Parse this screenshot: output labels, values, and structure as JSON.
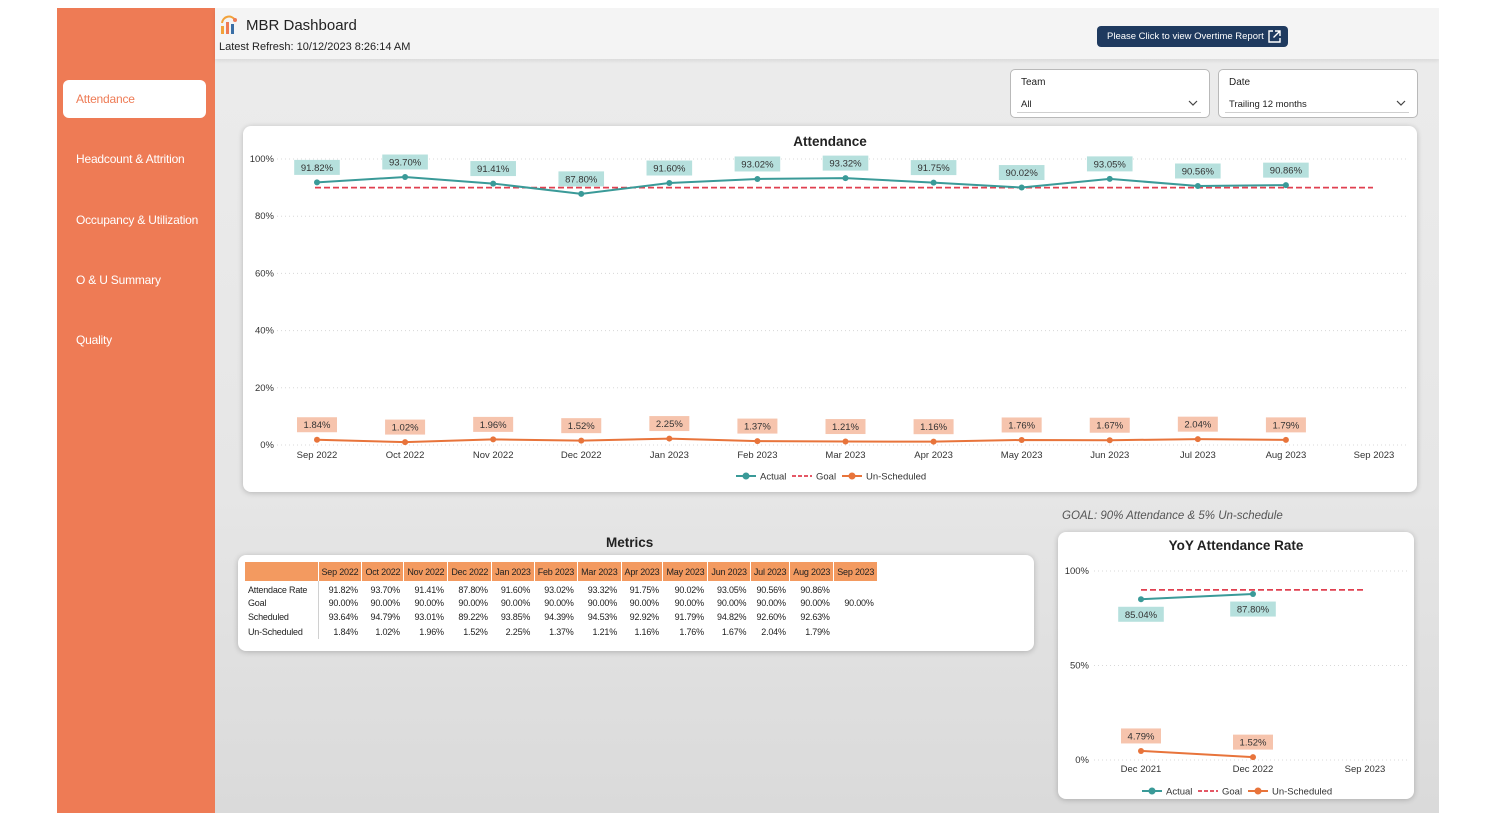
{
  "app": {
    "title": "MBR Dashboard",
    "refresh_label": "Latest Refresh: 10/12/2023 8:26:14 AM",
    "overtime_button": "Please Click to view Overtime Report"
  },
  "sidebar": {
    "items": [
      {
        "label": "Attendance",
        "active": true
      },
      {
        "label": "Headcount & Attrition",
        "active": false
      },
      {
        "label": "Occupancy & Utilization",
        "active": false
      },
      {
        "label": "O & U Summary",
        "active": false
      },
      {
        "label": "Quality",
        "active": false
      }
    ]
  },
  "filters": {
    "team": {
      "label": "Team",
      "value": "All"
    },
    "date": {
      "label": "Date",
      "value": "Trailing 12 months"
    }
  },
  "colors": {
    "brand": "#ee7b55",
    "actual": "#3a9a98",
    "goal": "#e04050",
    "unscheduled": "#e8743b",
    "actual_label_bg": "#b6e0dd",
    "unscheduled_label_bg": "#f6c4ad",
    "button": "#1f3a5f",
    "table_header": "#f39a60"
  },
  "goal_note": "GOAL: 90% Attendance & 5% Un-schedule",
  "chart_data": [
    {
      "type": "line",
      "title": "Attendance",
      "categories": [
        "Sep 2022",
        "Oct 2022",
        "Nov 2022",
        "Dec 2022",
        "Jan 2023",
        "Feb 2023",
        "Mar 2023",
        "Apr 2023",
        "May 2023",
        "Jun 2023",
        "Jul 2023",
        "Aug 2023",
        "Sep 2023"
      ],
      "yticks": [
        "100%",
        "80%",
        "60%",
        "40%",
        "20%",
        "0%"
      ],
      "ylim": [
        0,
        100
      ],
      "grid": true,
      "legend_position": "bottom-center",
      "series": [
        {
          "name": "Actual",
          "values": [
            91.82,
            93.7,
            91.41,
            87.8,
            91.6,
            93.02,
            93.32,
            91.75,
            90.02,
            93.05,
            90.56,
            90.86,
            null
          ],
          "labels": [
            "91.82%",
            "93.70%",
            "91.41%",
            "87.80%",
            "91.60%",
            "93.02%",
            "93.32%",
            "91.75%",
            "90.02%",
            "93.05%",
            "90.56%",
            "90.86%"
          ]
        },
        {
          "name": "Goal",
          "values": [
            90,
            90,
            90,
            90,
            90,
            90,
            90,
            90,
            90,
            90,
            90,
            90,
            90
          ]
        },
        {
          "name": "Un-Scheduled",
          "values": [
            1.84,
            1.02,
            1.96,
            1.52,
            2.25,
            1.37,
            1.21,
            1.16,
            1.76,
            1.67,
            2.04,
            1.79,
            null
          ],
          "labels": [
            "1.84%",
            "1.02%",
            "1.96%",
            "1.52%",
            "2.25%",
            "1.37%",
            "1.21%",
            "1.16%",
            "1.76%",
            "1.67%",
            "2.04%",
            "1.79%"
          ]
        }
      ]
    },
    {
      "type": "line",
      "title": "YoY Attendance Rate",
      "categories": [
        "Dec 2021",
        "Dec 2022",
        "Sep 2023"
      ],
      "yticks": [
        "100%",
        "50%",
        "0%"
      ],
      "ylim": [
        0,
        100
      ],
      "grid": true,
      "legend_position": "bottom-center",
      "series": [
        {
          "name": "Actual",
          "values": [
            85.04,
            87.8,
            null
          ],
          "labels": [
            "85.04%",
            "87.80%"
          ]
        },
        {
          "name": "Goal",
          "values": [
            90,
            90,
            90
          ]
        },
        {
          "name": "Un-Scheduled",
          "values": [
            4.79,
            1.52,
            null
          ],
          "labels": [
            "4.79%",
            "1.52%"
          ]
        }
      ]
    }
  ],
  "metrics": {
    "title": "Metrics",
    "columns": [
      "",
      "Sep 2022",
      "Oct 2022",
      "Nov 2022",
      "Dec 2022",
      "Jan 2023",
      "Feb 2023",
      "Mar 2023",
      "Apr 2023",
      "May 2023",
      "Jun 2023",
      "Jul 2023",
      "Aug 2023",
      "Sep 2023"
    ],
    "rows": [
      [
        "Attendace Rate",
        "91.82%",
        "93.70%",
        "91.41%",
        "87.80%",
        "91.60%",
        "93.02%",
        "93.32%",
        "91.75%",
        "90.02%",
        "93.05%",
        "90.56%",
        "90.86%",
        ""
      ],
      [
        "Goal",
        "90.00%",
        "90.00%",
        "90.00%",
        "90.00%",
        "90.00%",
        "90.00%",
        "90.00%",
        "90.00%",
        "90.00%",
        "90.00%",
        "90.00%",
        "90.00%",
        "90.00%"
      ],
      [
        "Scheduled",
        "93.64%",
        "94.79%",
        "93.01%",
        "89.22%",
        "93.85%",
        "94.39%",
        "94.53%",
        "92.92%",
        "91.79%",
        "94.82%",
        "92.60%",
        "92.63%",
        ""
      ],
      [
        "Un-Scheduled",
        "1.84%",
        "1.02%",
        "1.96%",
        "1.52%",
        "2.25%",
        "1.37%",
        "1.21%",
        "1.16%",
        "1.76%",
        "1.67%",
        "2.04%",
        "1.79%",
        ""
      ]
    ]
  }
}
